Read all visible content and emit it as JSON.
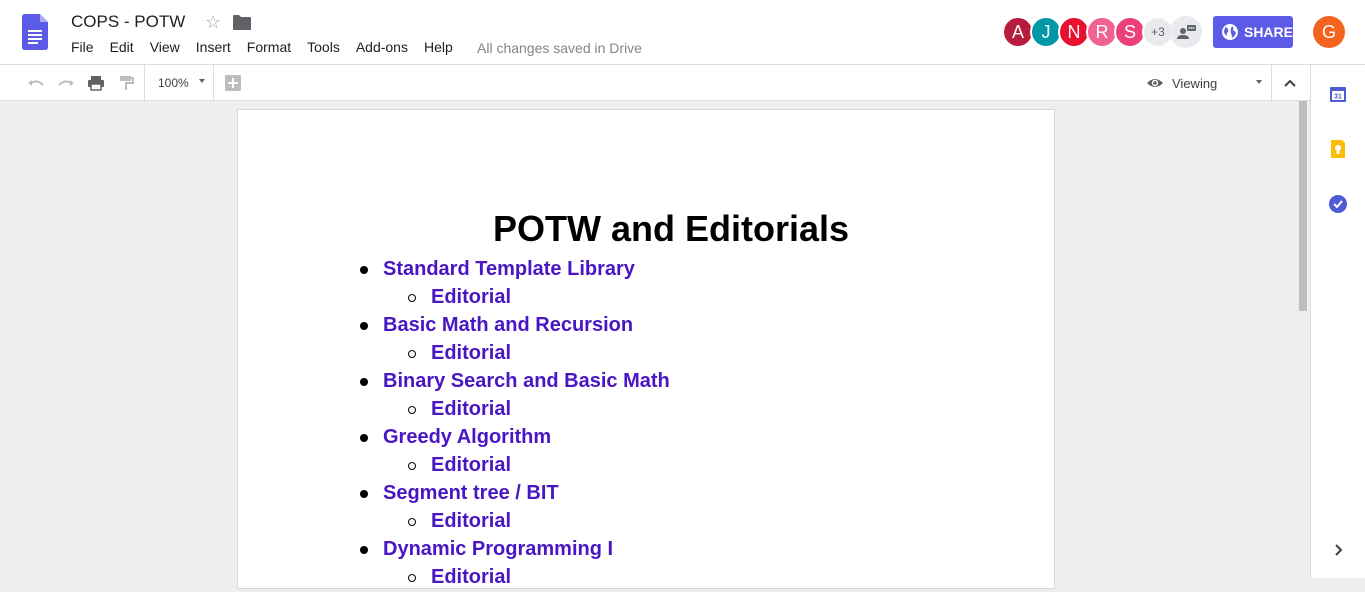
{
  "app": {
    "title": "COPS - POTW",
    "menu": [
      "File",
      "Edit",
      "View",
      "Insert",
      "Format",
      "Tools",
      "Add-ons",
      "Help"
    ],
    "save_status": "All changes saved in Drive",
    "share_label": "SHARE",
    "account_initial": "G"
  },
  "collaborators": [
    {
      "initial": "A",
      "color": "#b71c3c"
    },
    {
      "initial": "J",
      "color": "#0097a7"
    },
    {
      "initial": "N",
      "color": "#e8102d"
    },
    {
      "initial": "R",
      "color": "#f06292"
    },
    {
      "initial": "S",
      "color": "#ec407a"
    }
  ],
  "more_collaborators": "+3",
  "toolbar": {
    "zoom": "100%",
    "mode": "Viewing"
  },
  "document": {
    "heading": "POTW and Editorials",
    "items": [
      {
        "level": 1,
        "text": "Standard Template Library"
      },
      {
        "level": 2,
        "text": "Editorial"
      },
      {
        "level": 1,
        "text": "Basic Math and Recursion"
      },
      {
        "level": 2,
        "text": "Editorial"
      },
      {
        "level": 1,
        "text": "Binary Search and Basic Math"
      },
      {
        "level": 2,
        "text": "Editorial"
      },
      {
        "level": 1,
        "text": "Greedy Algorithm"
      },
      {
        "level": 2,
        "text": "Editorial"
      },
      {
        "level": 1,
        "text": "Segment tree / BIT"
      },
      {
        "level": 2,
        "text": "Editorial"
      },
      {
        "level": 1,
        "text": "Dynamic Programming I"
      },
      {
        "level": 2,
        "text": "Editorial"
      }
    ]
  },
  "icons": {
    "logo": "docs-logo-icon",
    "star": "star-icon",
    "folder": "folder-icon",
    "undo": "undo-icon",
    "redo": "redo-icon",
    "print": "print-icon",
    "paint_format": "paint-format-icon",
    "add_comment": "add-comment-icon",
    "eye": "eye-icon",
    "chevron_up": "chevron-up-icon",
    "calendar": "calendar-icon",
    "keep": "keep-icon",
    "tasks": "tasks-icon",
    "chevron_right": "chevron-right-icon"
  }
}
